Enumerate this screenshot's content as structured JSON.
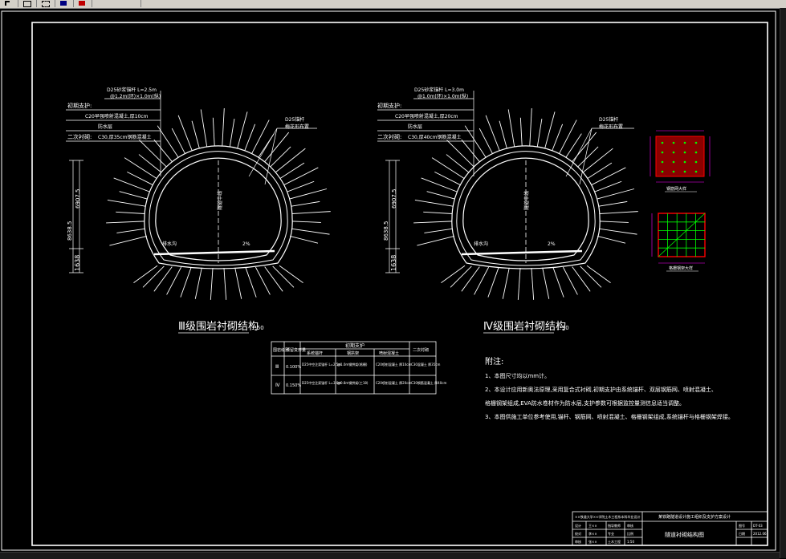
{
  "colors": {
    "background": "#000000",
    "line": "#ffffff",
    "accent_green": "#00ff00",
    "accent_red": "#ff0000",
    "accent_magenta": "#ff00ff",
    "accent_yellow": "#ffff00"
  },
  "toolbar": {
    "icons": [
      "pointer-icon",
      "rect-icon",
      "select-icon",
      "layer-icon",
      "color-icon"
    ]
  },
  "section3": {
    "title": "Ⅲ级围岩衬砌结构",
    "scale": "1:50",
    "labels": {
      "anchor_top": "D25砂浆锚杆 L=2.5m",
      "anchor_sub": "@1.2m(环)×1.0m(纵)",
      "primary_support": "初期支护:",
      "shotcrete": "C20早强喷射混凝土,厚10cm",
      "waterproof": "防水层",
      "secondary_lining": "二次衬砌:",
      "lining_concrete": "C30,厚35cm钢筋混凝土",
      "side_anchor": "D25锚杆",
      "side_anchor_sub": "梅花形布置",
      "center_dim": "隧道中线",
      "height_dim": "8638.5",
      "height_dim2": "6907.5",
      "invert_dim": "1638",
      "drain_label": "排水沟",
      "slope_label": "2%"
    }
  },
  "section4": {
    "title": "Ⅳ级围岩衬砌结构",
    "scale": "1:50",
    "labels": {
      "anchor_top": "D25砂浆锚杆 L=3.0m",
      "anchor_sub": "@1.0m(环)×1.0m(纵)",
      "primary_support": "初期支护:",
      "shotcrete": "C20早强喷射混凝土,厚20cm",
      "waterproof": "防水层",
      "secondary_lining": "二次衬砌:",
      "lining_concrete": "C30,厚40cm钢筋混凝土",
      "side_anchor": "D25锚杆",
      "side_anchor_sub": "梅花形布置",
      "center_dim": "隧道中线",
      "height_dim": "8638.5",
      "height_dim2": "6907.5",
      "invert_dim": "1638",
      "drain_label": "排水沟",
      "slope_label": "2%"
    }
  },
  "table": {
    "headers": [
      "围岩级别",
      "预留变形量",
      "初期支护",
      "二次衬砌"
    ],
    "subheaders": [
      "系统锚杆",
      "钢拱架",
      "喷射混凝土"
    ],
    "rows": [
      {
        "grade": "Ⅲ",
        "deform": "0.100%",
        "anchor": "D25中空注浆锚杆 L=2.5m",
        "arch": "@1.0m钢拱架(格栅)",
        "shot": "C20喷射混凝土 厚10cm",
        "lining": "C30混凝土 厚35cm"
      },
      {
        "grade": "Ⅳ",
        "deform": "0.150%",
        "anchor": "D25中空注浆锚杆 L=3.0m",
        "arch": "@0.8m钢拱架(工18)",
        "shot": "C20喷射混凝土 厚20cm",
        "lining": "C30钢筋混凝土 厚40cm"
      }
    ]
  },
  "notes": {
    "title": "附注:",
    "items": [
      "1、本图尺寸均以mm计。",
      "2、本设计应用新奥法原理,采用复合式衬砌,初期支护由系统锚杆、双层钢筋网、喷射混凝土、",
      "    格栅钢架组成,EVA防水卷材作为防水层,支护参数可根据监控量测信息适当调整。",
      "3、本图供施工单位参考使用,锚杆、钢筋网、喷射混凝土、格栅钢架组成,系统锚杆与格栅钢架焊接。"
    ]
  },
  "details": {
    "detail_a_label": "钢筋网大样",
    "detail_b_label": "格栅钢架大样"
  },
  "title_block": {
    "school": "××铁道大学××学院土木工程系本科毕业设计",
    "project": "某铁路隧道设计施工组织及支护方案设计",
    "drawing_name": "隧道衬砌结构图",
    "r1": [
      "设计",
      "王××",
      "指导教师",
      "审核"
    ],
    "r2": [
      "校对",
      "李××",
      "专业",
      "比例"
    ],
    "r3": [
      "审核",
      "张××",
      "土木工程",
      "1:50"
    ],
    "right": [
      "图号",
      "DT-03",
      "日期",
      "2012.06"
    ]
  }
}
